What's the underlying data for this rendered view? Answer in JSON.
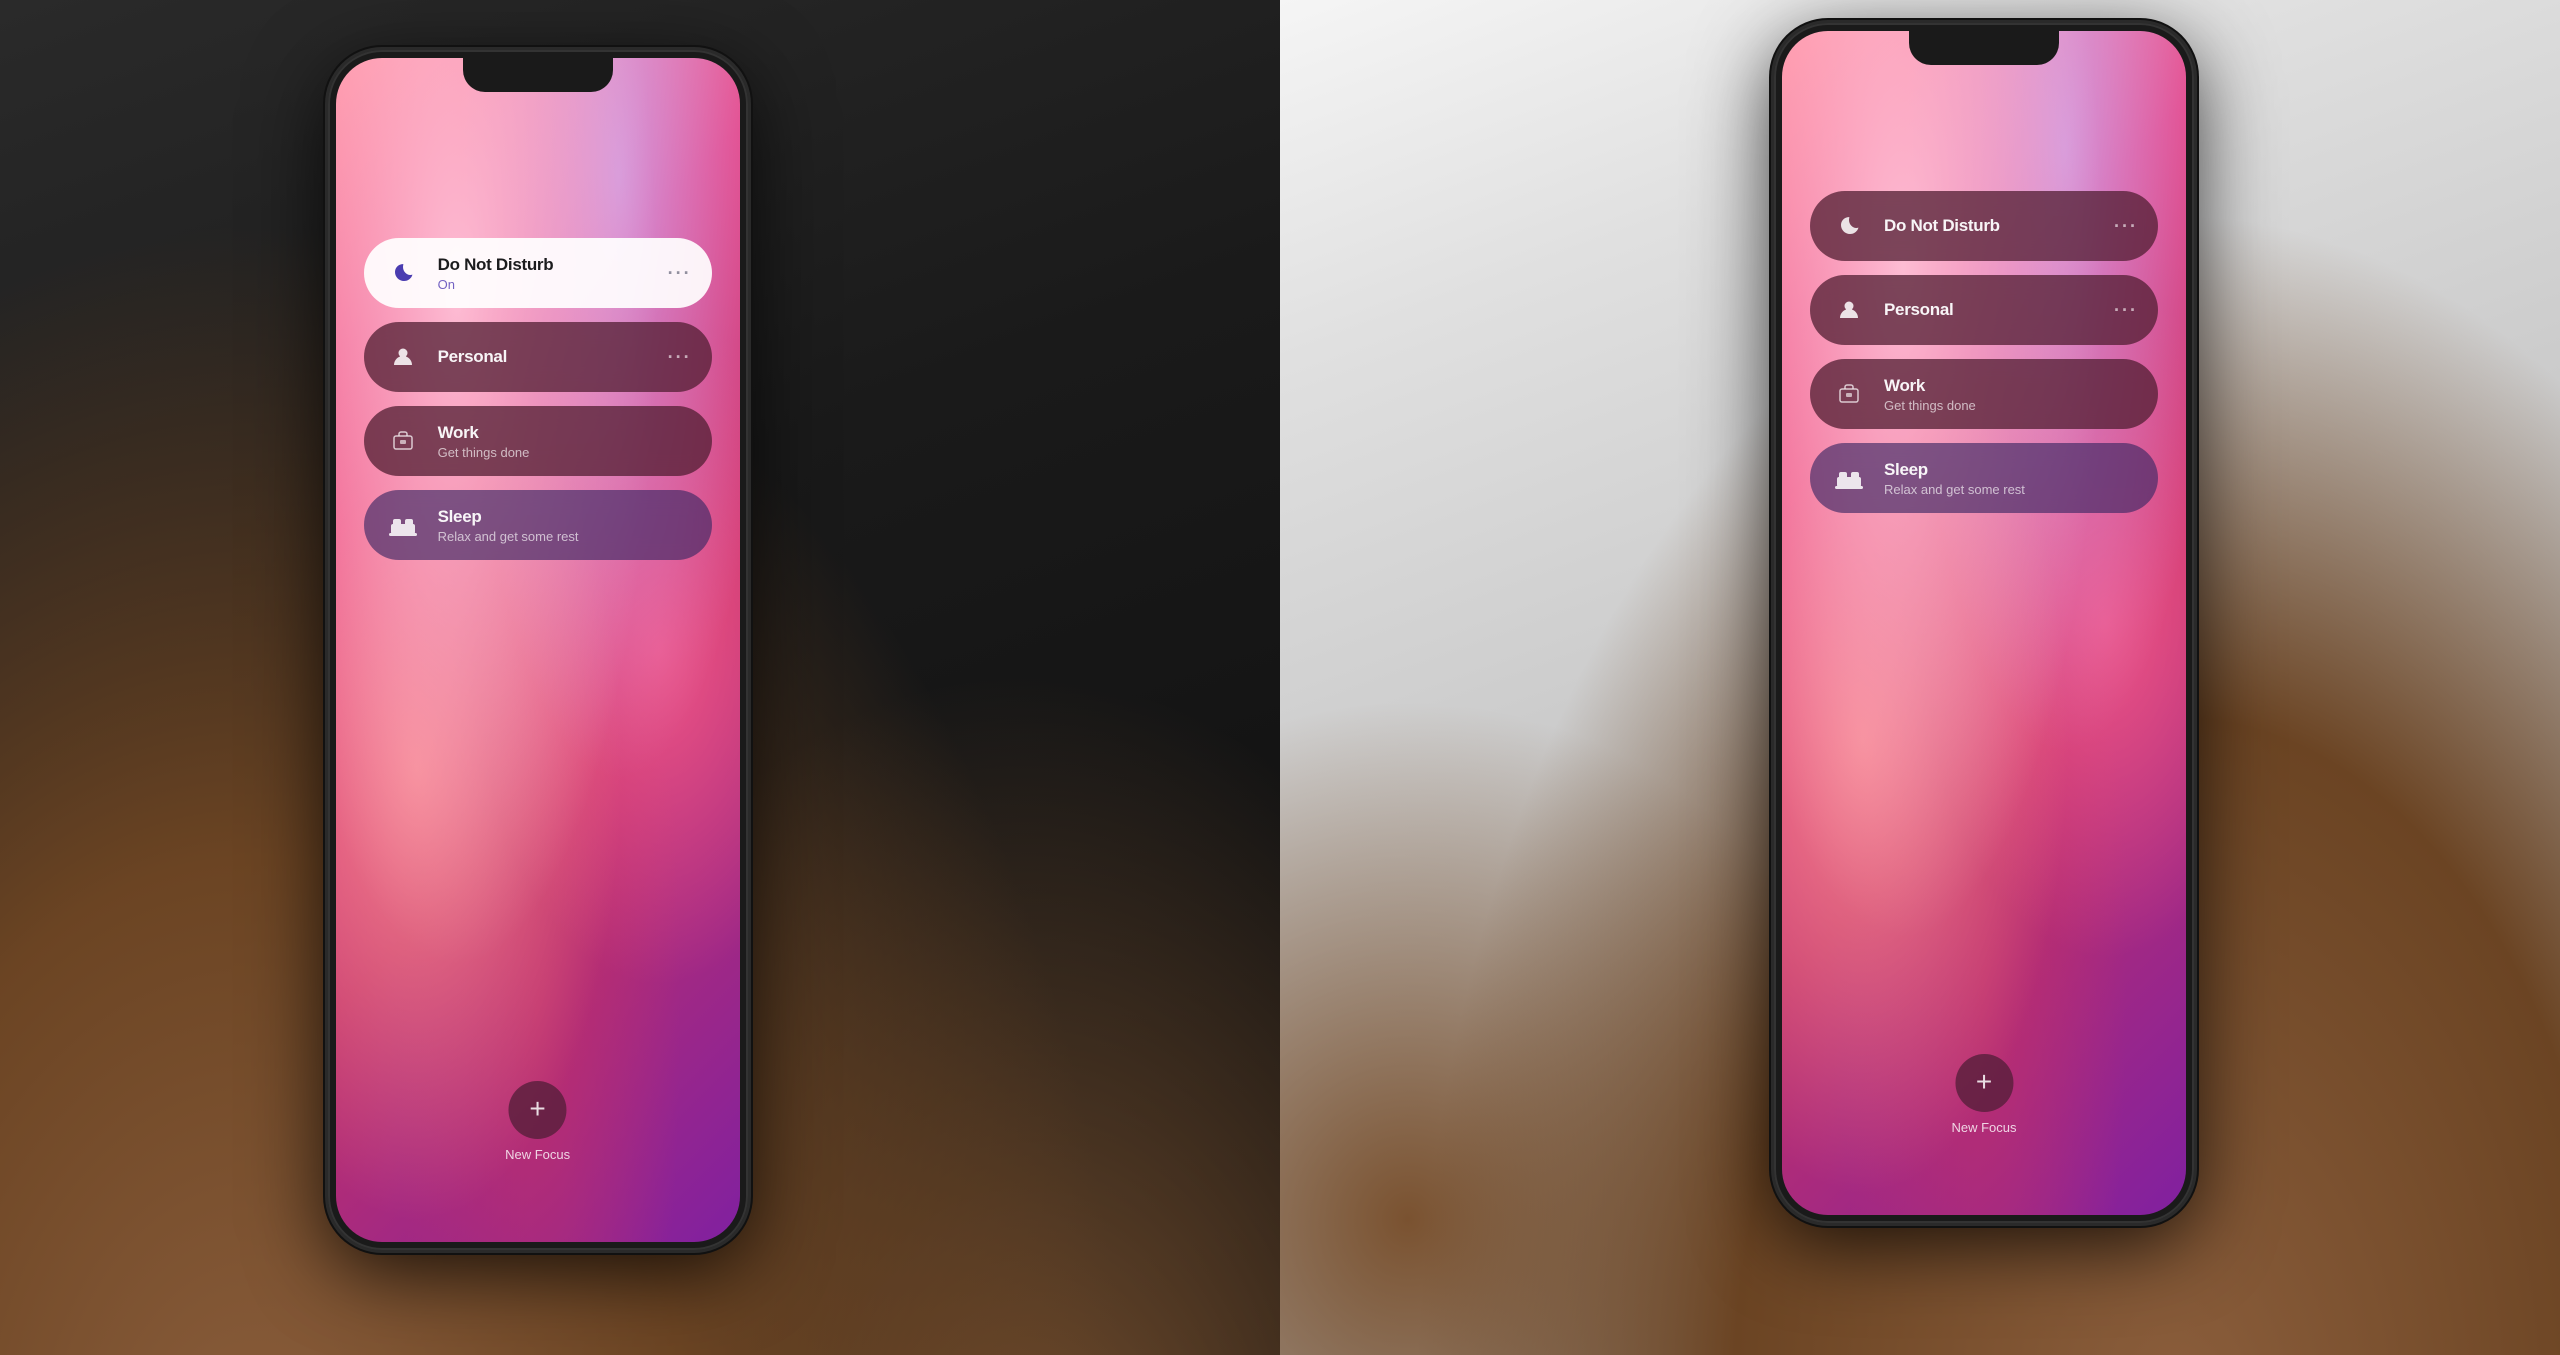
{
  "left_phone": {
    "focus_items": [
      {
        "id": "dnd",
        "title": "Do Not Disturb",
        "subtitle": "On",
        "subtitle_is_status": true,
        "icon": "🌙",
        "icon_type": "moon",
        "active": true,
        "has_more": true
      },
      {
        "id": "personal",
        "title": "Personal",
        "subtitle": "",
        "icon": "👤",
        "icon_type": "person",
        "active": false,
        "has_more": true
      },
      {
        "id": "work",
        "title": "Work",
        "subtitle": "Get things done",
        "icon": "🪪",
        "icon_type": "id-card",
        "active": false,
        "has_more": false
      },
      {
        "id": "sleep",
        "title": "Sleep",
        "subtitle": "Relax and get some rest",
        "icon": "🛏",
        "icon_type": "bed",
        "active": false,
        "has_more": false
      }
    ],
    "new_focus_label": "New Focus"
  },
  "right_phone": {
    "focus_items": [
      {
        "id": "dnd",
        "title": "Do Not Disturb",
        "subtitle": "",
        "icon": "🌙",
        "icon_type": "moon",
        "active": false,
        "has_more": true
      },
      {
        "id": "personal",
        "title": "Personal",
        "subtitle": "",
        "icon": "👤",
        "icon_type": "person",
        "active": false,
        "has_more": true
      },
      {
        "id": "work",
        "title": "Work",
        "subtitle": "Get things done",
        "icon": "🪪",
        "icon_type": "id-card",
        "active": false,
        "has_more": false
      },
      {
        "id": "sleep",
        "title": "Sleep",
        "subtitle": "Relax and get some rest",
        "icon": "🛏",
        "icon_type": "bed",
        "active": false,
        "has_more": false
      }
    ],
    "new_focus_label": "New Focus"
  }
}
